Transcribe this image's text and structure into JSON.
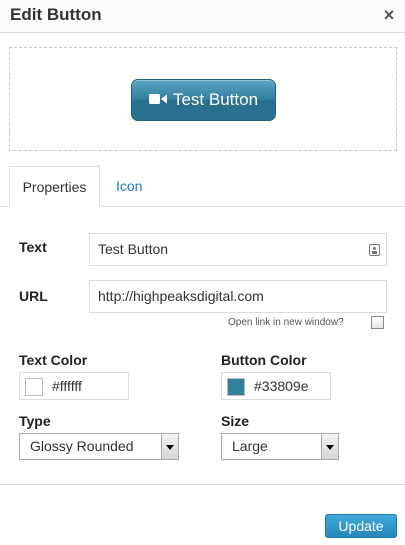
{
  "dialog": {
    "title": "Edit Button",
    "close_symbol": "×"
  },
  "preview": {
    "button_label": "Test Button",
    "button_icon": "video-camera-icon",
    "button_color": "#33809e"
  },
  "tabs": [
    {
      "label": "Properties",
      "active": true
    },
    {
      "label": "Icon",
      "active": false
    }
  ],
  "form": {
    "text_label": "Text",
    "text_value": "Test Button",
    "url_label": "URL",
    "url_value": "http://highpeaksdigital.com",
    "new_window_label": "Open link in new window?",
    "new_window_checked": false,
    "text_color_label": "Text Color",
    "text_color_value": "#ffffff",
    "button_color_label": "Button Color",
    "button_color_value": "#33809e",
    "type_label": "Type",
    "type_value": "Glossy Rounded",
    "size_label": "Size",
    "size_value": "Large"
  },
  "footer": {
    "update_label": "Update"
  },
  "colors": {
    "link": "#1e7db0",
    "primary_button": "#2687ba"
  }
}
